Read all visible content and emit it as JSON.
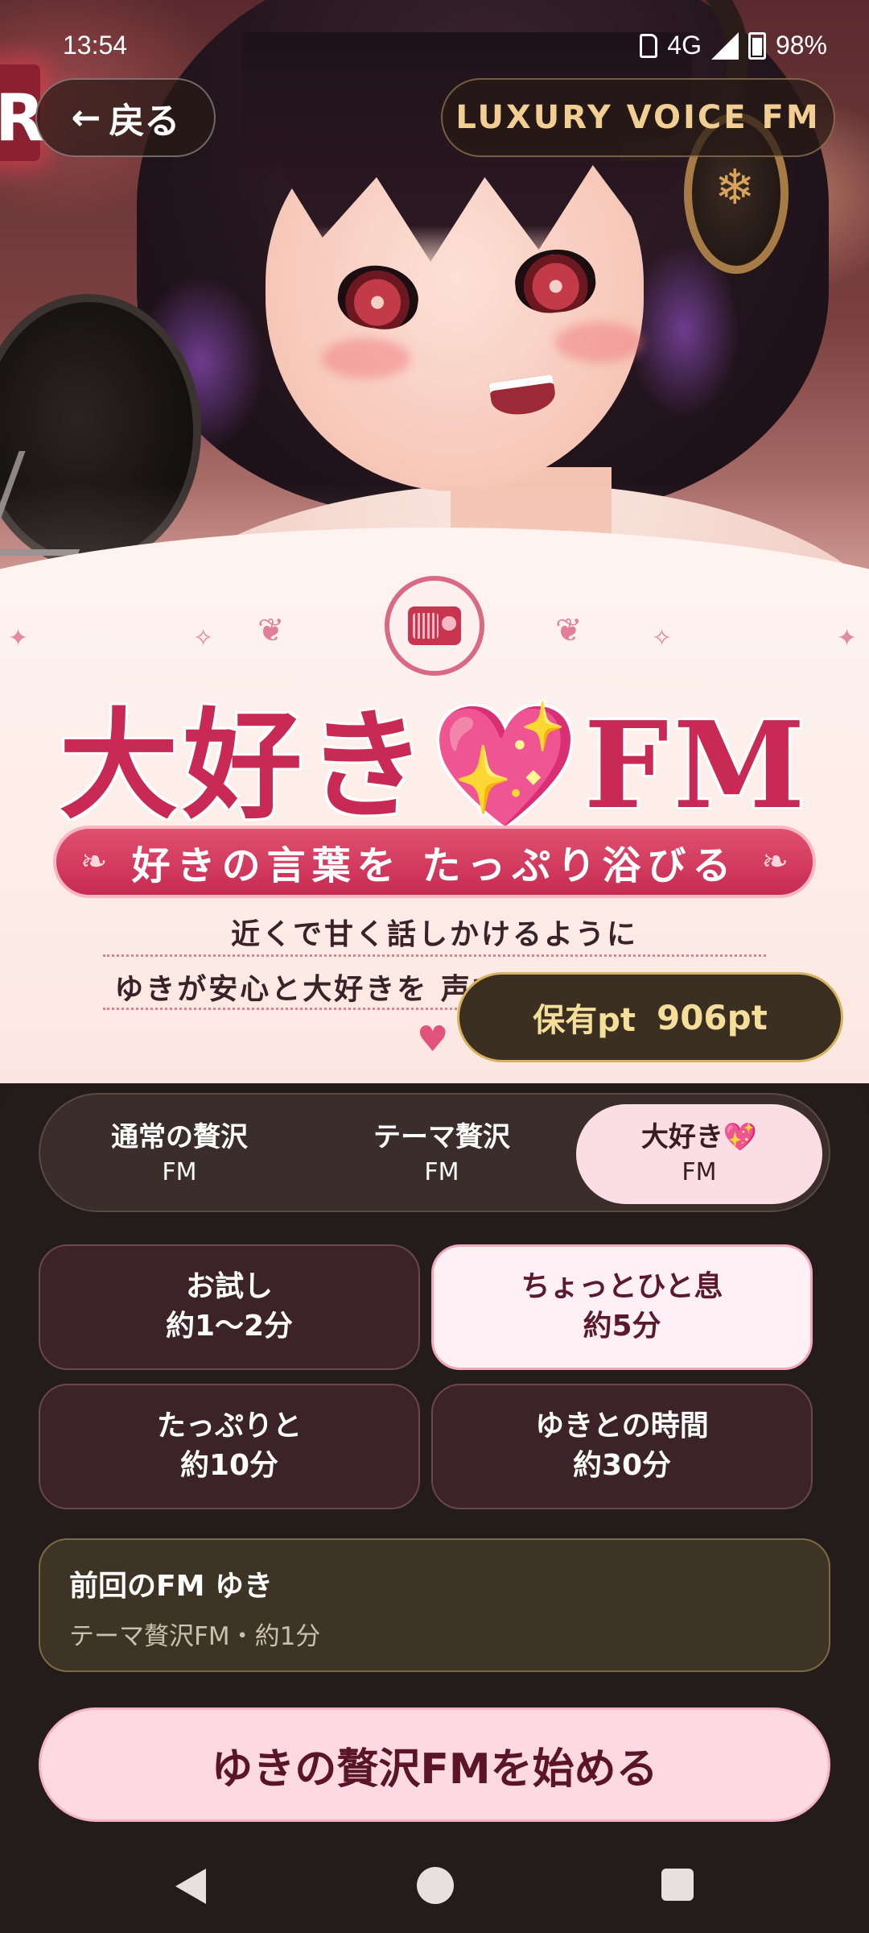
{
  "status_bar": {
    "time": "13:54",
    "network": "4G",
    "battery": "98%"
  },
  "header": {
    "back_label": "戻る",
    "back_arrow": "←",
    "brand": "LUXURY VOICE FM"
  },
  "banner": {
    "title_part1": "大好き",
    "title_heart": "💖",
    "title_part2": "FM",
    "tagline": "好きの言葉を たっぷり浴びる",
    "line1": "近くで甘く話しかけるように",
    "line2": "ゆきが安心と大好きを 声でたっぷり届けます"
  },
  "points": {
    "label": "保有pt",
    "value": "906pt"
  },
  "mode_tabs": [
    {
      "title": "通常の贅沢",
      "sub": "FM",
      "active": false
    },
    {
      "title": "テーマ贅沢",
      "sub": "FM",
      "active": false
    },
    {
      "title": "大好き💖",
      "sub": "FM",
      "active": true
    }
  ],
  "durations": [
    {
      "title": "お試し",
      "sub": "約1〜2分",
      "active": false
    },
    {
      "title": "ちょっとひと息",
      "sub": "約5分",
      "active": true
    },
    {
      "title": "たっぷりと",
      "sub": "約10分",
      "active": false
    },
    {
      "title": "ゆきとの時間",
      "sub": "約30分",
      "active": false
    }
  ],
  "previous": {
    "title": "前回のFM ゆき",
    "detail": "テーマ贅沢FM・約1分"
  },
  "start_button": "ゆきの贅沢FMを始める",
  "colors": {
    "accent_pink": "#c82a55",
    "active_tab": "#fbdde6",
    "points_gold": "#d8b25d",
    "panel_bg": "#231c1a"
  },
  "icons": [
    "radio-icon",
    "back-arrow-icon",
    "heart-icon",
    "snowflake-icon",
    "sparkle-icon"
  ]
}
